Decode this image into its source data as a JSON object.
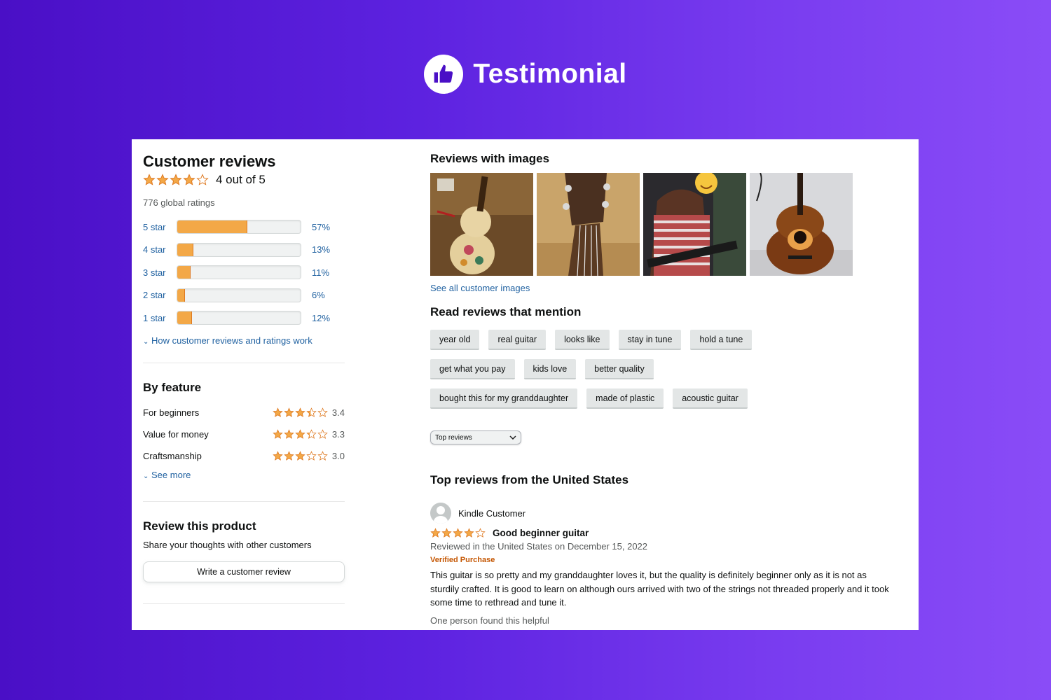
{
  "header": {
    "title": "Testimonial",
    "icon": "thumbs-up-icon"
  },
  "left": {
    "title": "Customer reviews",
    "average_stars": 4,
    "average_text": "4 out of 5",
    "global_ratings": "776 global ratings",
    "histogram": [
      {
        "label": "5 star",
        "percent_text": "57%",
        "percent": 57
      },
      {
        "label": "4 star",
        "percent_text": "13%",
        "percent": 13
      },
      {
        "label": "3 star",
        "percent_text": "11%",
        "percent": 11
      },
      {
        "label": "2 star",
        "percent_text": "6%",
        "percent": 6
      },
      {
        "label": "1 star",
        "percent_text": "12%",
        "percent": 12
      }
    ],
    "how_link": "How customer reviews and ratings work",
    "by_feature": {
      "title": "By feature",
      "items": [
        {
          "label": "For beginners",
          "score": "3.4",
          "rating": 3.4
        },
        {
          "label": "Value for money",
          "score": "3.3",
          "rating": 3.3
        },
        {
          "label": "Craftsmanship",
          "score": "3.0",
          "rating": 3.0
        }
      ],
      "see_more": "See more"
    },
    "review_product": {
      "title": "Review this product",
      "subtitle": "Share your thoughts with other customers",
      "button": "Write a customer review"
    }
  },
  "right": {
    "images_title": "Reviews with images",
    "see_all_images": "See all customer images",
    "mention_title": "Read reviews that mention",
    "chips": [
      "year old",
      "real guitar",
      "looks like",
      "stay in tune",
      "hold a tune",
      "get what you pay",
      "kids love",
      "better quality",
      "bought this for my granddaughter",
      "made of plastic",
      "acoustic guitar"
    ],
    "sort_select": "Top reviews",
    "top_reviews_title": "Top reviews from the United States",
    "review": {
      "author": "Kindle Customer",
      "stars": 4,
      "title": "Good beginner guitar",
      "meta": "Reviewed in the United States on December 15, 2022",
      "verified": "Verified Purchase",
      "body": "This guitar is so pretty and my granddaughter loves it, but the quality is definitely beginner only as it is not as sturdily crafted. It is good to learn on although ours arrived with two of the strings not threaded properly and it took some time to rethread and tune it.",
      "helpful": "One person found this helpful"
    }
  },
  "colors": {
    "star": "#f3a847",
    "star_stroke": "#de7921",
    "link": "#2162a1",
    "verified": "#c45500"
  }
}
